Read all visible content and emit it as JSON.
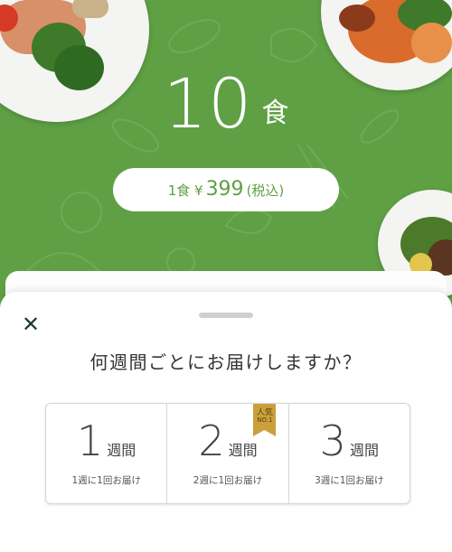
{
  "hero": {
    "count_number": "10",
    "count_unit": "食",
    "price_prefix": "1食 ¥",
    "price_value": "399",
    "price_suffix": "(税込)"
  },
  "sheet": {
    "close_label": "✕",
    "question": "何週間ごとにお届けしますか？",
    "options": [
      {
        "number": "1",
        "unit": "週間",
        "sub": "1週に1回お届け"
      },
      {
        "number": "2",
        "unit": "週間",
        "sub": "2週に1回お届け",
        "badge_line1": "人気",
        "badge_line2": "NO.1"
      },
      {
        "number": "3",
        "unit": "週間",
        "sub": "3週に1回お届け"
      }
    ]
  },
  "colors": {
    "brand_green": "#5fa044",
    "badge_gold": "#c9a03c"
  }
}
